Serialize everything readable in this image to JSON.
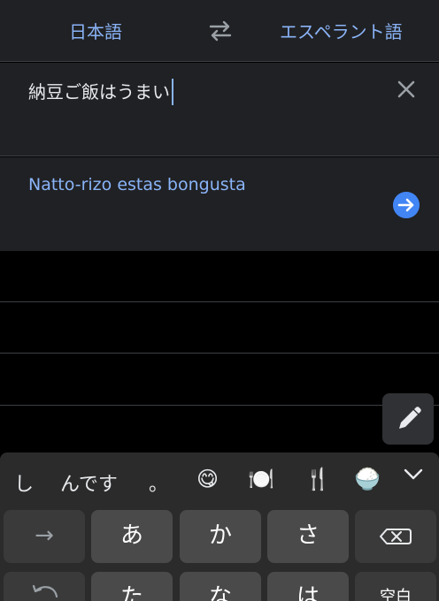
{
  "header": {
    "source_lang": "日本語",
    "target_lang": "エスペラント語",
    "swap_icon": "swap-arrows-icon"
  },
  "input": {
    "text": "納豆ご飯はうまい",
    "clear_icon": "close-icon"
  },
  "output": {
    "text": "Natto-rizo estas bongusta",
    "go_icon": "arrow-right-circle-icon"
  },
  "pen_icon": "pen-icon",
  "suggestions": {
    "words": [
      "し",
      "んです",
      "。"
    ],
    "emojis": [
      "😋",
      "🍽️",
      "🍴",
      "🍚"
    ],
    "collapse_icon": "chevron-down-icon"
  },
  "keyboard": {
    "row1": [
      "→",
      "あ",
      "か",
      "さ"
    ],
    "row2": [
      "た",
      "な",
      "は",
      "空白"
    ],
    "delete_icon": "backspace-icon",
    "undo_icon": "undo-icon"
  },
  "colors": {
    "accent": "#8ab4f8",
    "button_blue": "#4285f4",
    "panel_bg": "#202124"
  }
}
